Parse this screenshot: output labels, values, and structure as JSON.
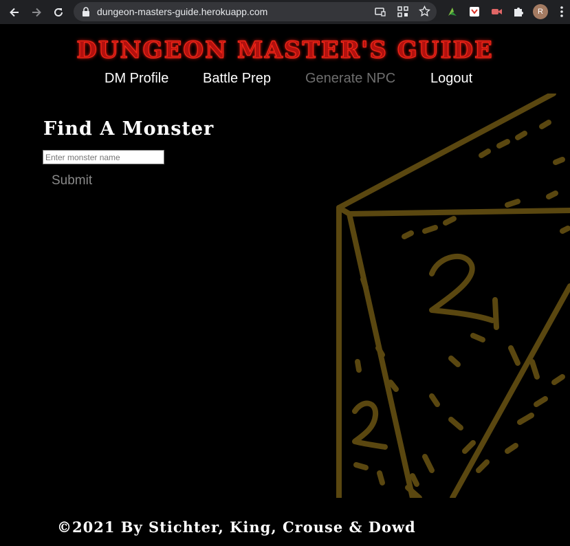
{
  "browser": {
    "url": "dungeon-masters-guide.herokuapp.com",
    "profile_initial": "R"
  },
  "site": {
    "logo_text": "DUNGEON MASTER'S GUIDE",
    "nav": [
      {
        "label": "DM Profile",
        "active": false
      },
      {
        "label": "Battle Prep",
        "active": false
      },
      {
        "label": "Generate NPC",
        "active": true
      },
      {
        "label": "Logout",
        "active": false
      }
    ]
  },
  "main": {
    "heading": "Find A Monster",
    "search_placeholder": "Enter monster name",
    "search_value": "",
    "submit_label": "Submit"
  },
  "footer": {
    "text": "©2021 By Stichter, King, Crouse & Dowd"
  },
  "colors": {
    "logo": "#b3110e",
    "dice": "#5a4710",
    "background": "#000000",
    "active_nav": "#6e6e6e"
  },
  "icons": [
    "back-arrow-icon",
    "forward-arrow-icon",
    "reload-icon",
    "lock-icon",
    "cast-icon",
    "qr-icon",
    "star-icon",
    "extension-icon",
    "puzzle-icon",
    "menu-icon"
  ]
}
